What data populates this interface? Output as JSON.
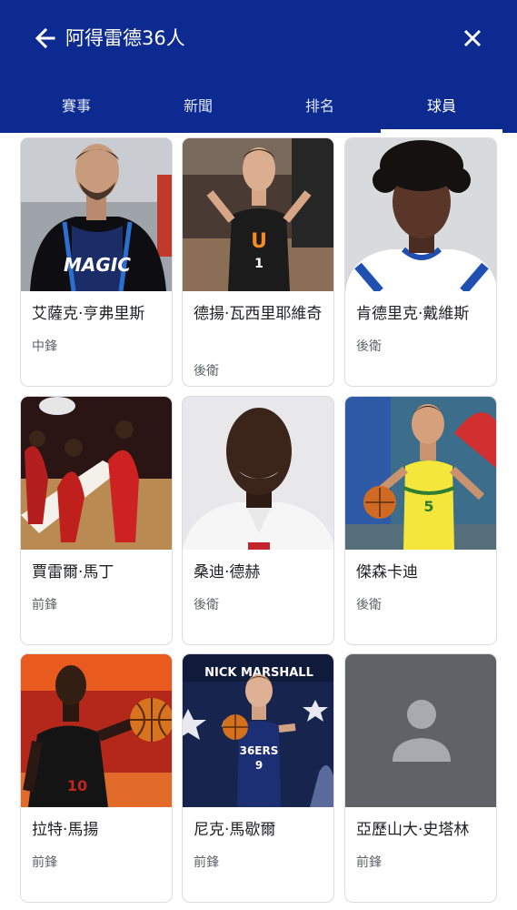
{
  "header": {
    "title": "阿得雷德36人",
    "tabs": [
      {
        "label": "賽事"
      },
      {
        "label": "新聞"
      },
      {
        "label": "排名"
      },
      {
        "label": "球員"
      }
    ],
    "active_tab": "球員",
    "background_color": "#0c2a8f"
  },
  "players": [
    {
      "name": "艾薩克·亨弗里斯",
      "position": "中鋒"
    },
    {
      "name": "德揚·瓦西里耶維奇",
      "position": "後衛"
    },
    {
      "name": "肯德里克·戴維斯",
      "position": "後衛"
    },
    {
      "name": "賈雷爾·馬丁",
      "position": "前鋒"
    },
    {
      "name": "桑迪·德赫",
      "position": "後衛"
    },
    {
      "name": "傑森卡迪",
      "position": "後衛"
    },
    {
      "name": "拉特·馬揚",
      "position": "前鋒"
    },
    {
      "name": "尼克·馬歇爾",
      "position": "前鋒"
    },
    {
      "name": "亞歷山大·史塔林",
      "position": "前鋒"
    }
  ],
  "photo_texts": {
    "jersey_1": "MAGIC",
    "jersey_2": "U",
    "jersey_6": "5",
    "banner_8": "NICK MARSHALL",
    "jersey_8": "36ERS"
  },
  "icons": {
    "back": "arrow-left-icon",
    "close": "close-icon",
    "placeholder": "person-placeholder-icon"
  }
}
